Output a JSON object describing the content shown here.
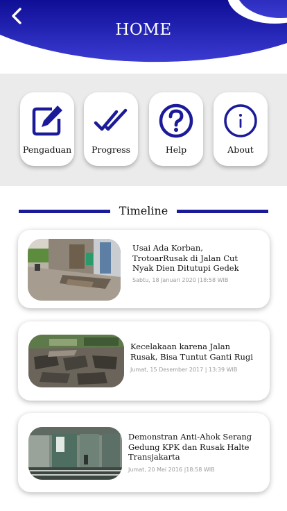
{
  "header": {
    "title": "HOME"
  },
  "menu": [
    {
      "label": "Pengaduan",
      "icon": "edit-icon"
    },
    {
      "label": "Progress",
      "icon": "double-check-icon"
    },
    {
      "label": "Help",
      "icon": "question-icon"
    },
    {
      "label": "About",
      "icon": "info-icon"
    }
  ],
  "timeline": {
    "title": "Timeline",
    "items": [
      {
        "title": "Usai Ada Korban, TrotoarRusak di Jalan Cut Nyak Dien Ditutupi Gedek",
        "date": "Sabtu, 18 Januari 2020 |18:58 WIB"
      },
      {
        "title": "Kecelakaan karena Jalan Rusak, Bisa Tuntut Ganti Rugi",
        "date": "Jumat, 15 Desember 2017 | 13:39 WIB"
      },
      {
        "title": "Demonstran Anti-Ahok Serang Gedung KPK dan Rusak Halte Transjakarta",
        "date": "Jumat, 20 Mei 2016 |18:58 WIB"
      }
    ]
  },
  "colors": {
    "primary": "#1b1b99",
    "header_top": "#12129a",
    "header_bottom": "#3a3ad0",
    "band": "#ebebeb"
  }
}
